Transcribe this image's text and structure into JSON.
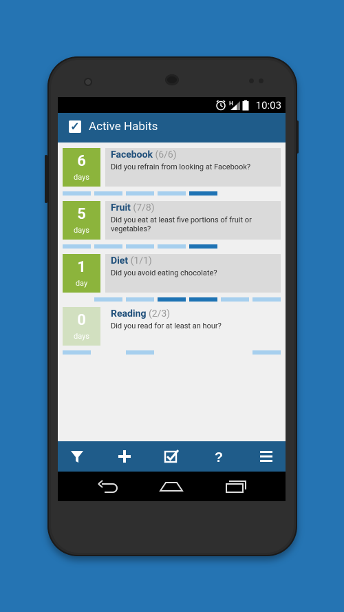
{
  "status_bar": {
    "time": "10:03",
    "icons": [
      "alarm-icon",
      "signal-icon",
      "battery-icon"
    ]
  },
  "app_bar": {
    "title": "Active Habits",
    "icon": "checkbox-icon"
  },
  "habits": [
    {
      "days": "6",
      "days_label": "days",
      "name": "Facebook",
      "progress": "(6/6)",
      "question": "Did you refrain from looking at Facebook?",
      "box_color": "#8cb43c",
      "segments": [
        "#a6cfee",
        "#a6cfee",
        "#a6cfee",
        "#a6cfee",
        "#1e73b4"
      ]
    },
    {
      "days": "5",
      "days_label": "days",
      "name": "Fruit",
      "progress": "(7/8)",
      "question": "Did you eat at least five portions of fruit or vegetables?",
      "box_color": "#8cb43c",
      "segments": [
        "#a6cfee",
        "#a6cfee",
        "#a6cfee",
        "#a6cfee",
        "#1e73b4"
      ]
    },
    {
      "days": "1",
      "days_label": "day",
      "name": "Diet",
      "progress": "(1/1)",
      "question": "Did you avoid eating chocolate?",
      "box_color": "#8cb43c",
      "segments": [
        "#a6cfee",
        "#a6cfee",
        "#1e73b4",
        "#a6cfee",
        "#a6cfee"
      ]
    },
    {
      "days": "0",
      "days_label": "days",
      "name": "Reading",
      "progress": "(2/3)",
      "question": "Did you read for at least an hour?",
      "box_color": "#d2e0c0",
      "segments": [
        "#a6cfee",
        "#a6cfee",
        "#a6cfee"
      ]
    }
  ],
  "bottom_toolbar": [
    {
      "icon": "filter-icon",
      "name": "filter-button"
    },
    {
      "icon": "plus-icon",
      "name": "add-habit-button"
    },
    {
      "icon": "checklist-icon",
      "name": "check-in-button"
    },
    {
      "icon": "help-icon",
      "name": "help-button"
    },
    {
      "icon": "menu-icon",
      "name": "menu-button"
    }
  ],
  "system_nav": [
    "back-icon",
    "home-icon",
    "recents-icon"
  ],
  "colors": {
    "background": "#2574b3",
    "app_bar": "#1f5c8a",
    "day_box_active": "#8cb43c",
    "day_box_inactive": "#d2e0c0",
    "segment_light": "#a6cfee",
    "segment_dark": "#1e73b4"
  }
}
